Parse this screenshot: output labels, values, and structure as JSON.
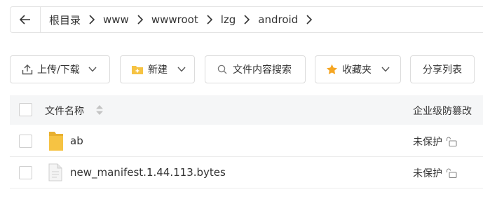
{
  "breadcrumb": {
    "back_icon": "arrow-left-icon",
    "items": [
      "根目录",
      "www",
      "wwwroot",
      "lzg",
      "android"
    ],
    "separator_icon": "chevron-right-icon"
  },
  "toolbar": {
    "upload_label": "上传/下载",
    "new_label": "新建",
    "search_label": "文件内容搜索",
    "favorites_label": "收藏夹",
    "share_list_label": "分享列表"
  },
  "table": {
    "name_header": "文件名称",
    "protect_header": "企业级防篡改",
    "rows": [
      {
        "name": "ab",
        "type": "folder",
        "status": "未保护"
      },
      {
        "name": "new_manifest.1.44.113.bytes",
        "type": "file",
        "status": "未保护"
      }
    ]
  },
  "colors": {
    "folder": "#f6c343",
    "star": "#f5a623",
    "border": "#dcdcdc",
    "header_bg": "#f5f6f7"
  }
}
